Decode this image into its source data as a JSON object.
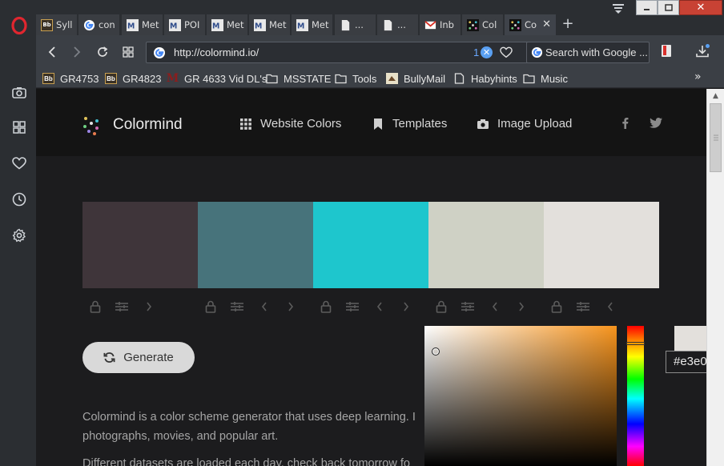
{
  "browser": {
    "tabs": [
      {
        "label": "Syll",
        "icon": "blackboard-icon"
      },
      {
        "label": "con",
        "icon": "google-icon"
      },
      {
        "label": "Met",
        "icon": "msstate-icon"
      },
      {
        "label": "POI",
        "icon": "msstate-icon"
      },
      {
        "label": "Met",
        "icon": "msstate-icon"
      },
      {
        "label": "Met",
        "icon": "msstate-icon"
      },
      {
        "label": "Met",
        "icon": "msstate-icon"
      },
      {
        "label": "...",
        "icon": "document-icon"
      },
      {
        "label": "...",
        "icon": "document-icon"
      },
      {
        "label": "Inb",
        "icon": "gmail-icon"
      },
      {
        "label": "Col",
        "icon": "colormind-icon"
      },
      {
        "label": "Co",
        "icon": "colormind-icon",
        "active": true
      }
    ],
    "new_tab_label": "+",
    "url": "http://colormind.io/",
    "adblock_count": "1",
    "search_placeholder": "Search with Google ...",
    "bookmarks": [
      {
        "label": "GR4753",
        "icon": "blackboard-icon"
      },
      {
        "label": "GR4823",
        "icon": "blackboard-icon"
      },
      {
        "label": "GR 4633 Vid DL's",
        "icon": "maroon-m-icon"
      },
      {
        "label": "MSSTATE",
        "icon": "folder-icon"
      },
      {
        "label": "Tools",
        "icon": "folder-icon"
      },
      {
        "label": "BullyMail",
        "icon": "bullymail-icon"
      },
      {
        "label": "Habyhints",
        "icon": "document-icon"
      },
      {
        "label": "Music",
        "icon": "folder-icon"
      }
    ],
    "bookmarks_overflow": "»"
  },
  "site": {
    "brand": "Colormind",
    "nav": [
      {
        "label": "Website Colors",
        "icon": "grid-icon"
      },
      {
        "label": "Templates",
        "icon": "bookmark-icon"
      },
      {
        "label": "Image Upload",
        "icon": "camera-icon"
      }
    ],
    "social": [
      "facebook-icon",
      "twitter-icon"
    ],
    "palette": [
      "#3f353a",
      "#47737b",
      "#1ec6cd",
      "#cfd1c5",
      "#e3e0dc"
    ],
    "generate_label": "Generate",
    "description_lines": [
      "Colormind is a color scheme generator that uses deep learning. I",
      "photographs, movies, and popular art.",
      "Different datasets are loaded each day, check back tomorrow fo"
    ]
  },
  "picker": {
    "hex_value": "#e3e0",
    "hue_color": "#f7941d",
    "preview_color": "#e3e0dc"
  }
}
